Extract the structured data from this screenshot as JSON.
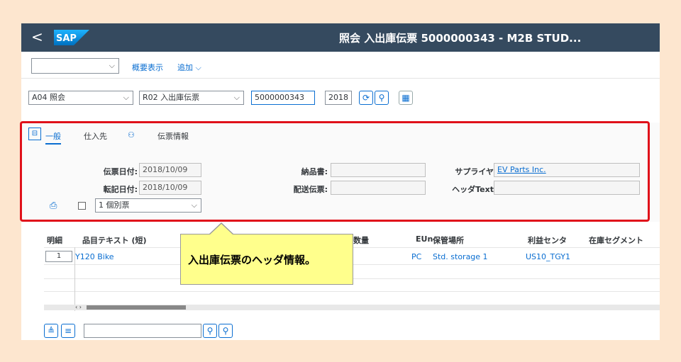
{
  "shellbar": {
    "back": "<",
    "logo": "SAP",
    "title": "照会 入出庫伝票 5000000343 - M2B STUD..."
  },
  "toolbar": {
    "dropdown_value": "",
    "overview_label": "概要表示",
    "add_label": "追加"
  },
  "controls": {
    "action_select": "A04 照会",
    "document_select": "R02 入出庫伝票",
    "document_number": "5000000343",
    "year": "2018"
  },
  "header_tabs": [
    {
      "label": "一般",
      "active": true
    },
    {
      "label": "仕入先",
      "active": false
    },
    {
      "label": "",
      "active": false
    },
    {
      "label": "伝票情報",
      "active": false
    }
  ],
  "header_fields": {
    "doc_date_label": "伝票日付:",
    "doc_date_value": "2018/10/09",
    "posting_date_label": "転記日付:",
    "posting_date_value": "2018/10/09",
    "delivery_note_label": "納品書:",
    "delivery_note_value": "",
    "bill_of_lading_label": "配送伝票:",
    "bill_of_lading_value": "",
    "supplier_label": "サプライヤ",
    "supplier_value": "EV Parts Inc.",
    "header_text_label": "ヘッダText",
    "header_text_value": "",
    "print_option": "1 個別票"
  },
  "table": {
    "headers": [
      "明細",
      "品目テキスト (短)",
      "数量",
      "EUn",
      "保管場所",
      "利益センタ",
      "在庫セグメント"
    ],
    "rows": [
      {
        "item": "1",
        "material": "Y120 Bike",
        "quantity": "",
        "unit": "PC",
        "storage": "Std. storage 1",
        "profit_center": "US10_TGY1",
        "segment": ""
      }
    ]
  },
  "callout": {
    "text": "入出庫伝票のヘッダ情報。"
  },
  "colors": {
    "shellbar": "#354a5f",
    "accent": "#0a6ed1",
    "highlight_frame": "#e0111a",
    "callout_bg": "#ffff8c",
    "page_bg": "#fde6cf"
  }
}
